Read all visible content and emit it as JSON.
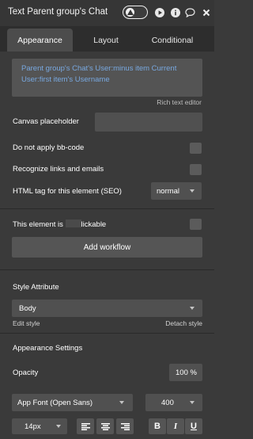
{
  "header": {
    "title": "Text Parent group's Chat",
    "icons": [
      "preview-toggle-icon",
      "play-icon",
      "info-icon",
      "comment-icon",
      "close-icon"
    ]
  },
  "tabs": [
    {
      "label": "Appearance",
      "active": true
    },
    {
      "label": "Layout",
      "active": false
    },
    {
      "label": "Conditional",
      "active": false
    }
  ],
  "content": {
    "text": "Parent group's Chat's User:minus item Current User:first item's Username",
    "rich_text_label": "Rich text editor"
  },
  "properties": {
    "canvas_placeholder_label": "Canvas placeholder",
    "canvas_placeholder_value": "",
    "no_bbcode_label": "Do not apply bb-code",
    "recognize_links_label": "Recognize links and emails",
    "html_tag_label": "HTML tag for this element (SEO)",
    "html_tag_value": "normal"
  },
  "clickable": {
    "label_start": "This element is ",
    "label_end": "lickable"
  },
  "workflow": {
    "add_label": "Add workflow"
  },
  "style": {
    "section_title": "Style Attribute",
    "value": "Body",
    "edit_label": "Edit style",
    "detach_label": "Detach style"
  },
  "appearance": {
    "section_title": "Appearance Settings",
    "opacity_label": "Opacity",
    "opacity_value": "100",
    "opacity_unit": "%",
    "font_value": "App Font (Open Sans)",
    "weight_value": "400",
    "size_value": "14px",
    "align_icons": [
      "align-left-icon",
      "align-center-icon",
      "align-right-icon"
    ],
    "format_buttons": [
      "B",
      "I",
      "U"
    ]
  },
  "colors": {
    "panel_bg": "#3a3a3a",
    "tab_bar_bg": "#2d2d2d",
    "field_bg": "#505050",
    "link_text": "#78a8e0"
  }
}
